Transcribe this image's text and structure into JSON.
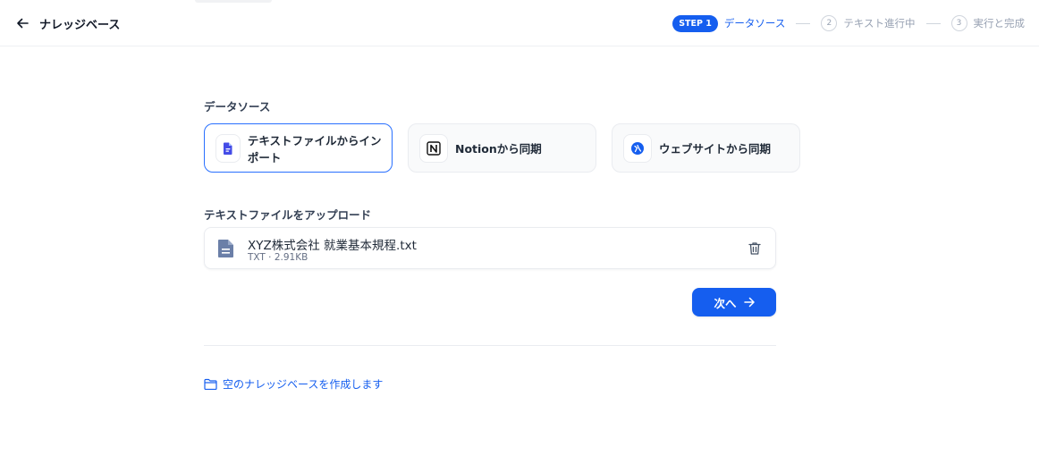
{
  "header": {
    "title": "ナレッジベース"
  },
  "stepper": {
    "step1_badge": "STEP 1",
    "step1_label": "データソース",
    "step2_num": "2",
    "step2_label": "テキスト進行中",
    "step3_num": "3",
    "step3_label": "実行と完成"
  },
  "data_source": {
    "section_label": "データソース",
    "options": [
      {
        "label": "テキストファイルからインポート",
        "icon": "file-text-icon",
        "selected": true
      },
      {
        "label": "Notionから同期",
        "icon": "notion-icon",
        "selected": false
      },
      {
        "label": "ウェブサイトから同期",
        "icon": "website-icon",
        "selected": false
      }
    ]
  },
  "upload": {
    "section_label": "テキストファイルをアップロード",
    "file": {
      "name": "XYZ株式会社 就業基本規程.txt",
      "meta": "TXT · 2.91KB"
    }
  },
  "actions": {
    "next_label": "次へ",
    "create_empty_label": "空のナレッジベースを作成します"
  },
  "colors": {
    "accent": "#155eef",
    "selected_border": "#2970ff",
    "file_icon": "#6b7fa8"
  }
}
